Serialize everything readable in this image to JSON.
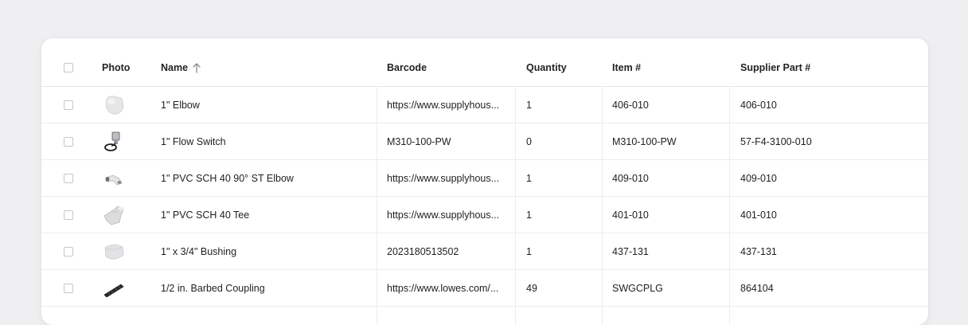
{
  "table": {
    "columns": {
      "photo": "Photo",
      "name": "Name",
      "barcode": "Barcode",
      "quantity": "Quantity",
      "item": "Item #",
      "supplier": "Supplier Part #"
    },
    "sort": {
      "column": "Name",
      "direction": "ascending",
      "icon": "arrow-up-icon"
    },
    "rows": [
      {
        "name": "1\" Elbow",
        "barcode": "https://www.supplyhous...",
        "quantity": "1",
        "item": "406-010",
        "supplier": "406-010",
        "photo_icon": "pvc-elbow-photo"
      },
      {
        "name": "1\" Flow Switch",
        "barcode": "M310-100-PW",
        "quantity": "0",
        "item": "M310-100-PW",
        "supplier": "57-F4-3100-010",
        "photo_icon": "flow-switch-photo"
      },
      {
        "name": "1\" PVC SCH 40 90° ST Elbow",
        "barcode": "https://www.supplyhous...",
        "quantity": "1",
        "item": "409-010",
        "supplier": "409-010",
        "photo_icon": "st-elbow-photo"
      },
      {
        "name": "1\" PVC SCH 40 Tee",
        "barcode": "https://www.supplyhous...",
        "quantity": "1",
        "item": "401-010",
        "supplier": "401-010",
        "photo_icon": "pvc-tee-photo"
      },
      {
        "name": "1\" x 3/4\" Bushing",
        "barcode": "2023180513502",
        "quantity": "1",
        "item": "437-131",
        "supplier": "437-131",
        "photo_icon": "bushing-photo"
      },
      {
        "name": "1/2 in. Barbed Coupling",
        "barcode": "https://www.lowes.com/...",
        "quantity": "49",
        "item": "SWGCPLG",
        "supplier": "864104",
        "photo_icon": "barbed-coupling-photo"
      }
    ]
  }
}
